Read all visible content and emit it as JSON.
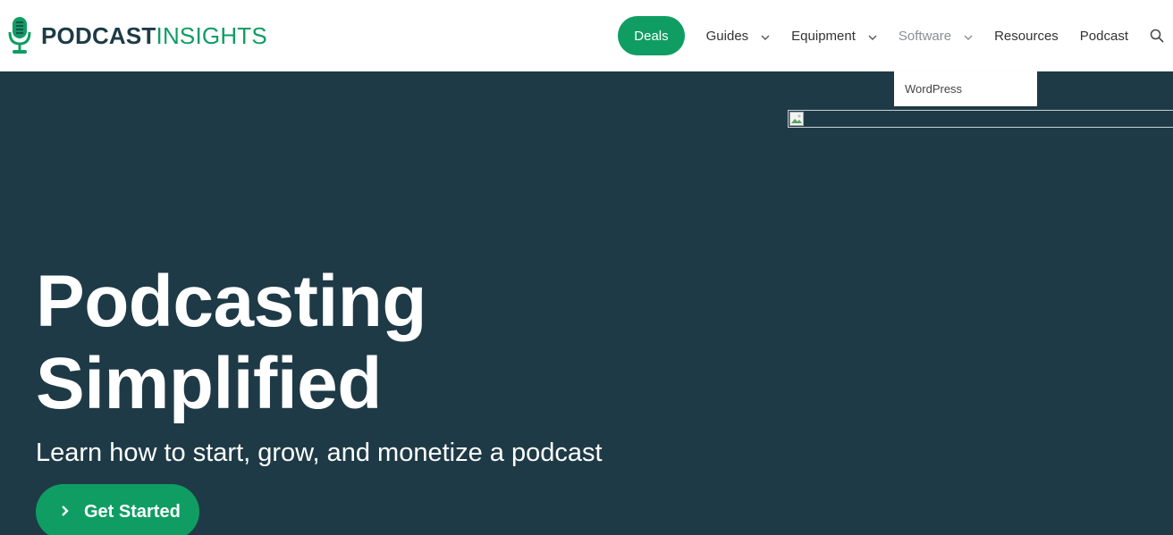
{
  "header": {
    "logo": {
      "text_bold": "PODCAST",
      "text_light": "INSIGHTS",
      "icon": "microphone-icon"
    },
    "nav": {
      "deals_label": "Deals",
      "items": [
        {
          "label": "Guides",
          "has_dropdown": true
        },
        {
          "label": "Equipment",
          "has_dropdown": true
        },
        {
          "label": "Software",
          "has_dropdown": true,
          "active_hover": true
        },
        {
          "label": "Resources",
          "has_dropdown": false
        },
        {
          "label": "Podcast",
          "has_dropdown": false
        }
      ],
      "search_icon": "search-icon"
    },
    "software_dropdown": {
      "items": [
        "WordPress"
      ]
    }
  },
  "hero": {
    "title_line1": "Podcasting",
    "title_line2": "Simplified",
    "subtitle": "Learn how to start, grow, and monetize a podcast",
    "cta_label": "Get Started",
    "cta_icon": "chevron-right-icon"
  },
  "colors": {
    "brand_green": "#0f9d63",
    "brand_dark": "#1e3a46",
    "hero_bg": "#1e3a46",
    "nav_text": "#333333",
    "nav_muted": "#8a8f93"
  }
}
